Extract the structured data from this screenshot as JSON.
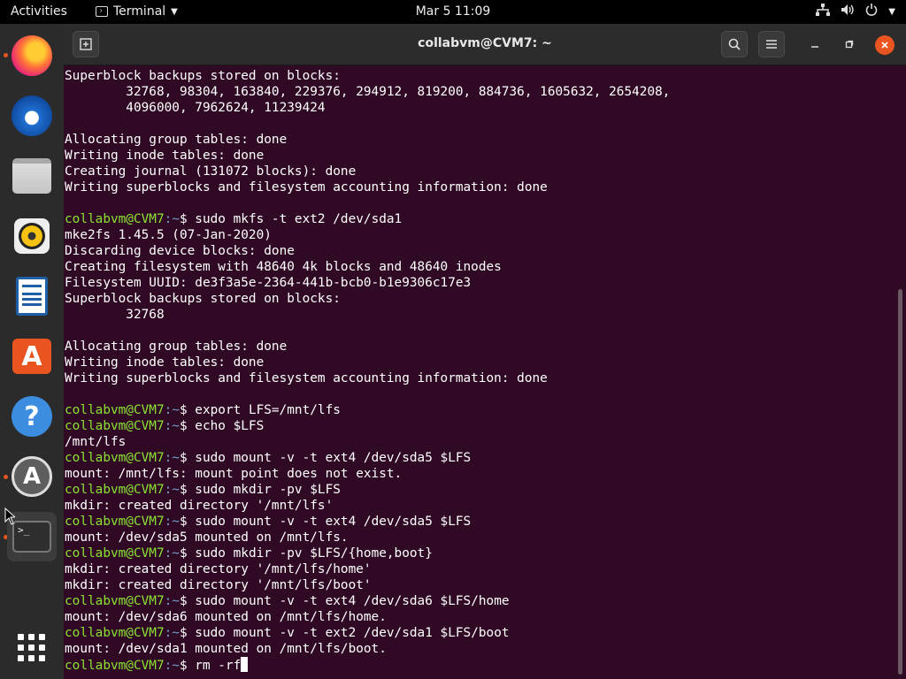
{
  "topbar": {
    "activities": "Activities",
    "app_menu": "Terminal",
    "clock": "Mar 5  11:09"
  },
  "dock": {
    "items": [
      {
        "name": "firefox",
        "running": true
      },
      {
        "name": "thunderbird",
        "running": false
      },
      {
        "name": "files",
        "running": false
      },
      {
        "name": "rhythmbox",
        "running": false
      },
      {
        "name": "libreoffice-writer",
        "running": false
      },
      {
        "name": "ubuntu-software",
        "running": false
      },
      {
        "name": "help",
        "running": false
      },
      {
        "name": "software-updater",
        "running": true
      },
      {
        "name": "terminal",
        "running": true
      }
    ]
  },
  "window": {
    "title": "collabvm@CVM7: ~"
  },
  "terminal": {
    "lines": [
      {
        "text": "Superblock backups stored on blocks:"
      },
      {
        "text": "        32768, 98304, 163840, 229376, 294912, 819200, 884736, 1605632, 2654208,"
      },
      {
        "text": "        4096000, 7962624, 11239424"
      },
      {
        "text": ""
      },
      {
        "text": "Allocating group tables: done"
      },
      {
        "text": "Writing inode tables: done"
      },
      {
        "text": "Creating journal (131072 blocks): done"
      },
      {
        "text": "Writing superblocks and filesystem accounting information: done"
      },
      {
        "text": ""
      },
      {
        "prompt": true,
        "text": "sudo mkfs -t ext2 /dev/sda1"
      },
      {
        "text": "mke2fs 1.45.5 (07-Jan-2020)"
      },
      {
        "text": "Discarding device blocks: done"
      },
      {
        "text": "Creating filesystem with 48640 4k blocks and 48640 inodes"
      },
      {
        "text": "Filesystem UUID: de3f3a5e-2364-441b-bcb0-b1e9306c17e3"
      },
      {
        "text": "Superblock backups stored on blocks:"
      },
      {
        "text": "        32768"
      },
      {
        "text": ""
      },
      {
        "text": "Allocating group tables: done"
      },
      {
        "text": "Writing inode tables: done"
      },
      {
        "text": "Writing superblocks and filesystem accounting information: done"
      },
      {
        "text": ""
      },
      {
        "prompt": true,
        "text": "export LFS=/mnt/lfs"
      },
      {
        "prompt": true,
        "text": "echo $LFS"
      },
      {
        "text": "/mnt/lfs"
      },
      {
        "prompt": true,
        "text": "sudo mount -v -t ext4 /dev/sda5 $LFS"
      },
      {
        "text": "mount: /mnt/lfs: mount point does not exist."
      },
      {
        "prompt": true,
        "text": "sudo mkdir -pv $LFS"
      },
      {
        "text": "mkdir: created directory '/mnt/lfs'"
      },
      {
        "prompt": true,
        "text": "sudo mount -v -t ext4 /dev/sda5 $LFS"
      },
      {
        "text": "mount: /dev/sda5 mounted on /mnt/lfs."
      },
      {
        "prompt": true,
        "text": "sudo mkdir -pv $LFS/{home,boot}"
      },
      {
        "text": "mkdir: created directory '/mnt/lfs/home'"
      },
      {
        "text": "mkdir: created directory '/mnt/lfs/boot'"
      },
      {
        "prompt": true,
        "text": "sudo mount -v -t ext4 /dev/sda6 $LFS/home"
      },
      {
        "text": "mount: /dev/sda6 mounted on /mnt/lfs/home."
      },
      {
        "prompt": true,
        "text": "sudo mount -v -t ext2 /dev/sda1 $LFS/boot"
      },
      {
        "text": "mount: /dev/sda1 mounted on /mnt/lfs/boot."
      },
      {
        "prompt": true,
        "text": "rm -rf",
        "cursor": true
      }
    ],
    "prompt_user": "collabvm@CVM7",
    "prompt_sep": ":~",
    "prompt_sym": "$ "
  }
}
